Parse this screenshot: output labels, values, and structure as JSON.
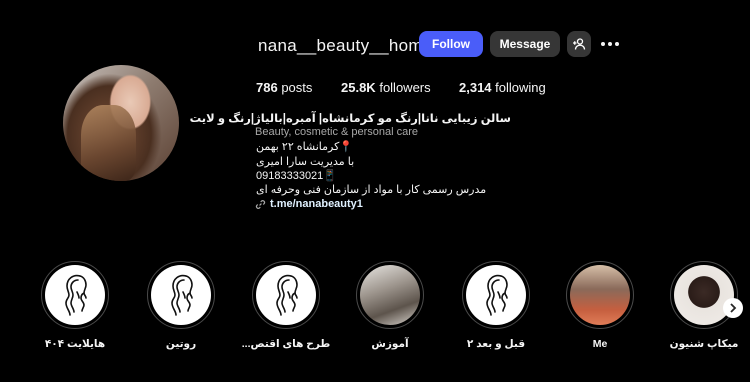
{
  "profile": {
    "username": "nana__beauty__home",
    "follow_label": "Follow",
    "message_label": "Message",
    "add_user_icon": "person-add-icon",
    "more_icon": "more-horizontal-icon"
  },
  "stats": {
    "posts_count": "786",
    "posts_label": "posts",
    "followers_count": "25.8K",
    "followers_label": "followers",
    "following_count": "2,314",
    "following_label": "following"
  },
  "bio": {
    "name": "سالن زیبایی نانا|رنگ مو کرمانشاه| آمبره|بالیاژ|رنگ و لایت",
    "category": "Beauty, cosmetic & personal care",
    "line1": "📍کرمانشاه ۲۲ بهمن",
    "line2": "با مدیریت سارا امیری",
    "line3": "09183333021📱",
    "line4": "مدرس رسمی کار با مواد از سازمان فنی وحرفه ای",
    "link": "t.me/nanabeauty1",
    "link_icon": "link-icon"
  },
  "highlights": [
    {
      "label": "هایلایت ۴۰۴",
      "type": "silhouette"
    },
    {
      "label": "روتین",
      "type": "silhouette"
    },
    {
      "label": "طرح های اقتص...",
      "type": "silhouette"
    },
    {
      "label": "آموزش",
      "type": "photo-hair"
    },
    {
      "label": "قبل و بعد ۲",
      "type": "silhouette"
    },
    {
      "label": "Me",
      "type": "photo-me"
    },
    {
      "label": "میکاپ شنیون",
      "type": "photo-sh"
    }
  ],
  "next_icon": "chevron-right-icon",
  "colors": {
    "background": "#000000",
    "follow_button": "#4a5df9",
    "secondary_button": "#363636",
    "muted_text": "#a8a8a8"
  }
}
